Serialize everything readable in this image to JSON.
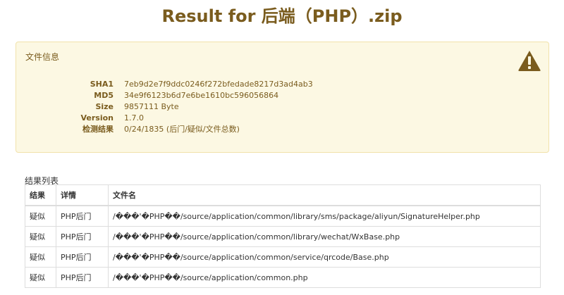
{
  "page": {
    "title": "Result for 后端（PHP）.zip"
  },
  "info_panel": {
    "heading": "文件信息",
    "rows": [
      {
        "label": "SHA1",
        "value": "7eb9d2e7f9ddc0246f272bfedade8217d3ad4ab3"
      },
      {
        "label": "MD5",
        "value": "34e9f6123b6d7e6be1610bc596056864"
      },
      {
        "label": "Size",
        "value": "9857111 Byte"
      },
      {
        "label": "Version",
        "value": "1.7.0"
      },
      {
        "label": "检测结果",
        "value": "0/24/1835 (后门/疑似/文件总数)"
      }
    ],
    "icon": "warning-triangle",
    "colors": {
      "background": "#fcf8e3",
      "text": "#7a5c1e",
      "border": "#f1e2ab"
    }
  },
  "results": {
    "caption": "结果列表",
    "headers": [
      "结果",
      "详情",
      "文件名"
    ],
    "rows": [
      {
        "result": "疑似",
        "detail": "PHP后门",
        "filename": "/���'�PHP��/source/application/common/library/sms/package/aliyun/SignatureHelper.php"
      },
      {
        "result": "疑似",
        "detail": "PHP后门",
        "filename": "/���'�PHP��/source/application/common/library/wechat/WxBase.php"
      },
      {
        "result": "疑似",
        "detail": "PHP后门",
        "filename": "/���'�PHP��/source/application/common/service/qrcode/Base.php"
      },
      {
        "result": "疑似",
        "detail": "PHP后门",
        "filename": "/���'�PHP��/source/application/common.php"
      }
    ]
  }
}
